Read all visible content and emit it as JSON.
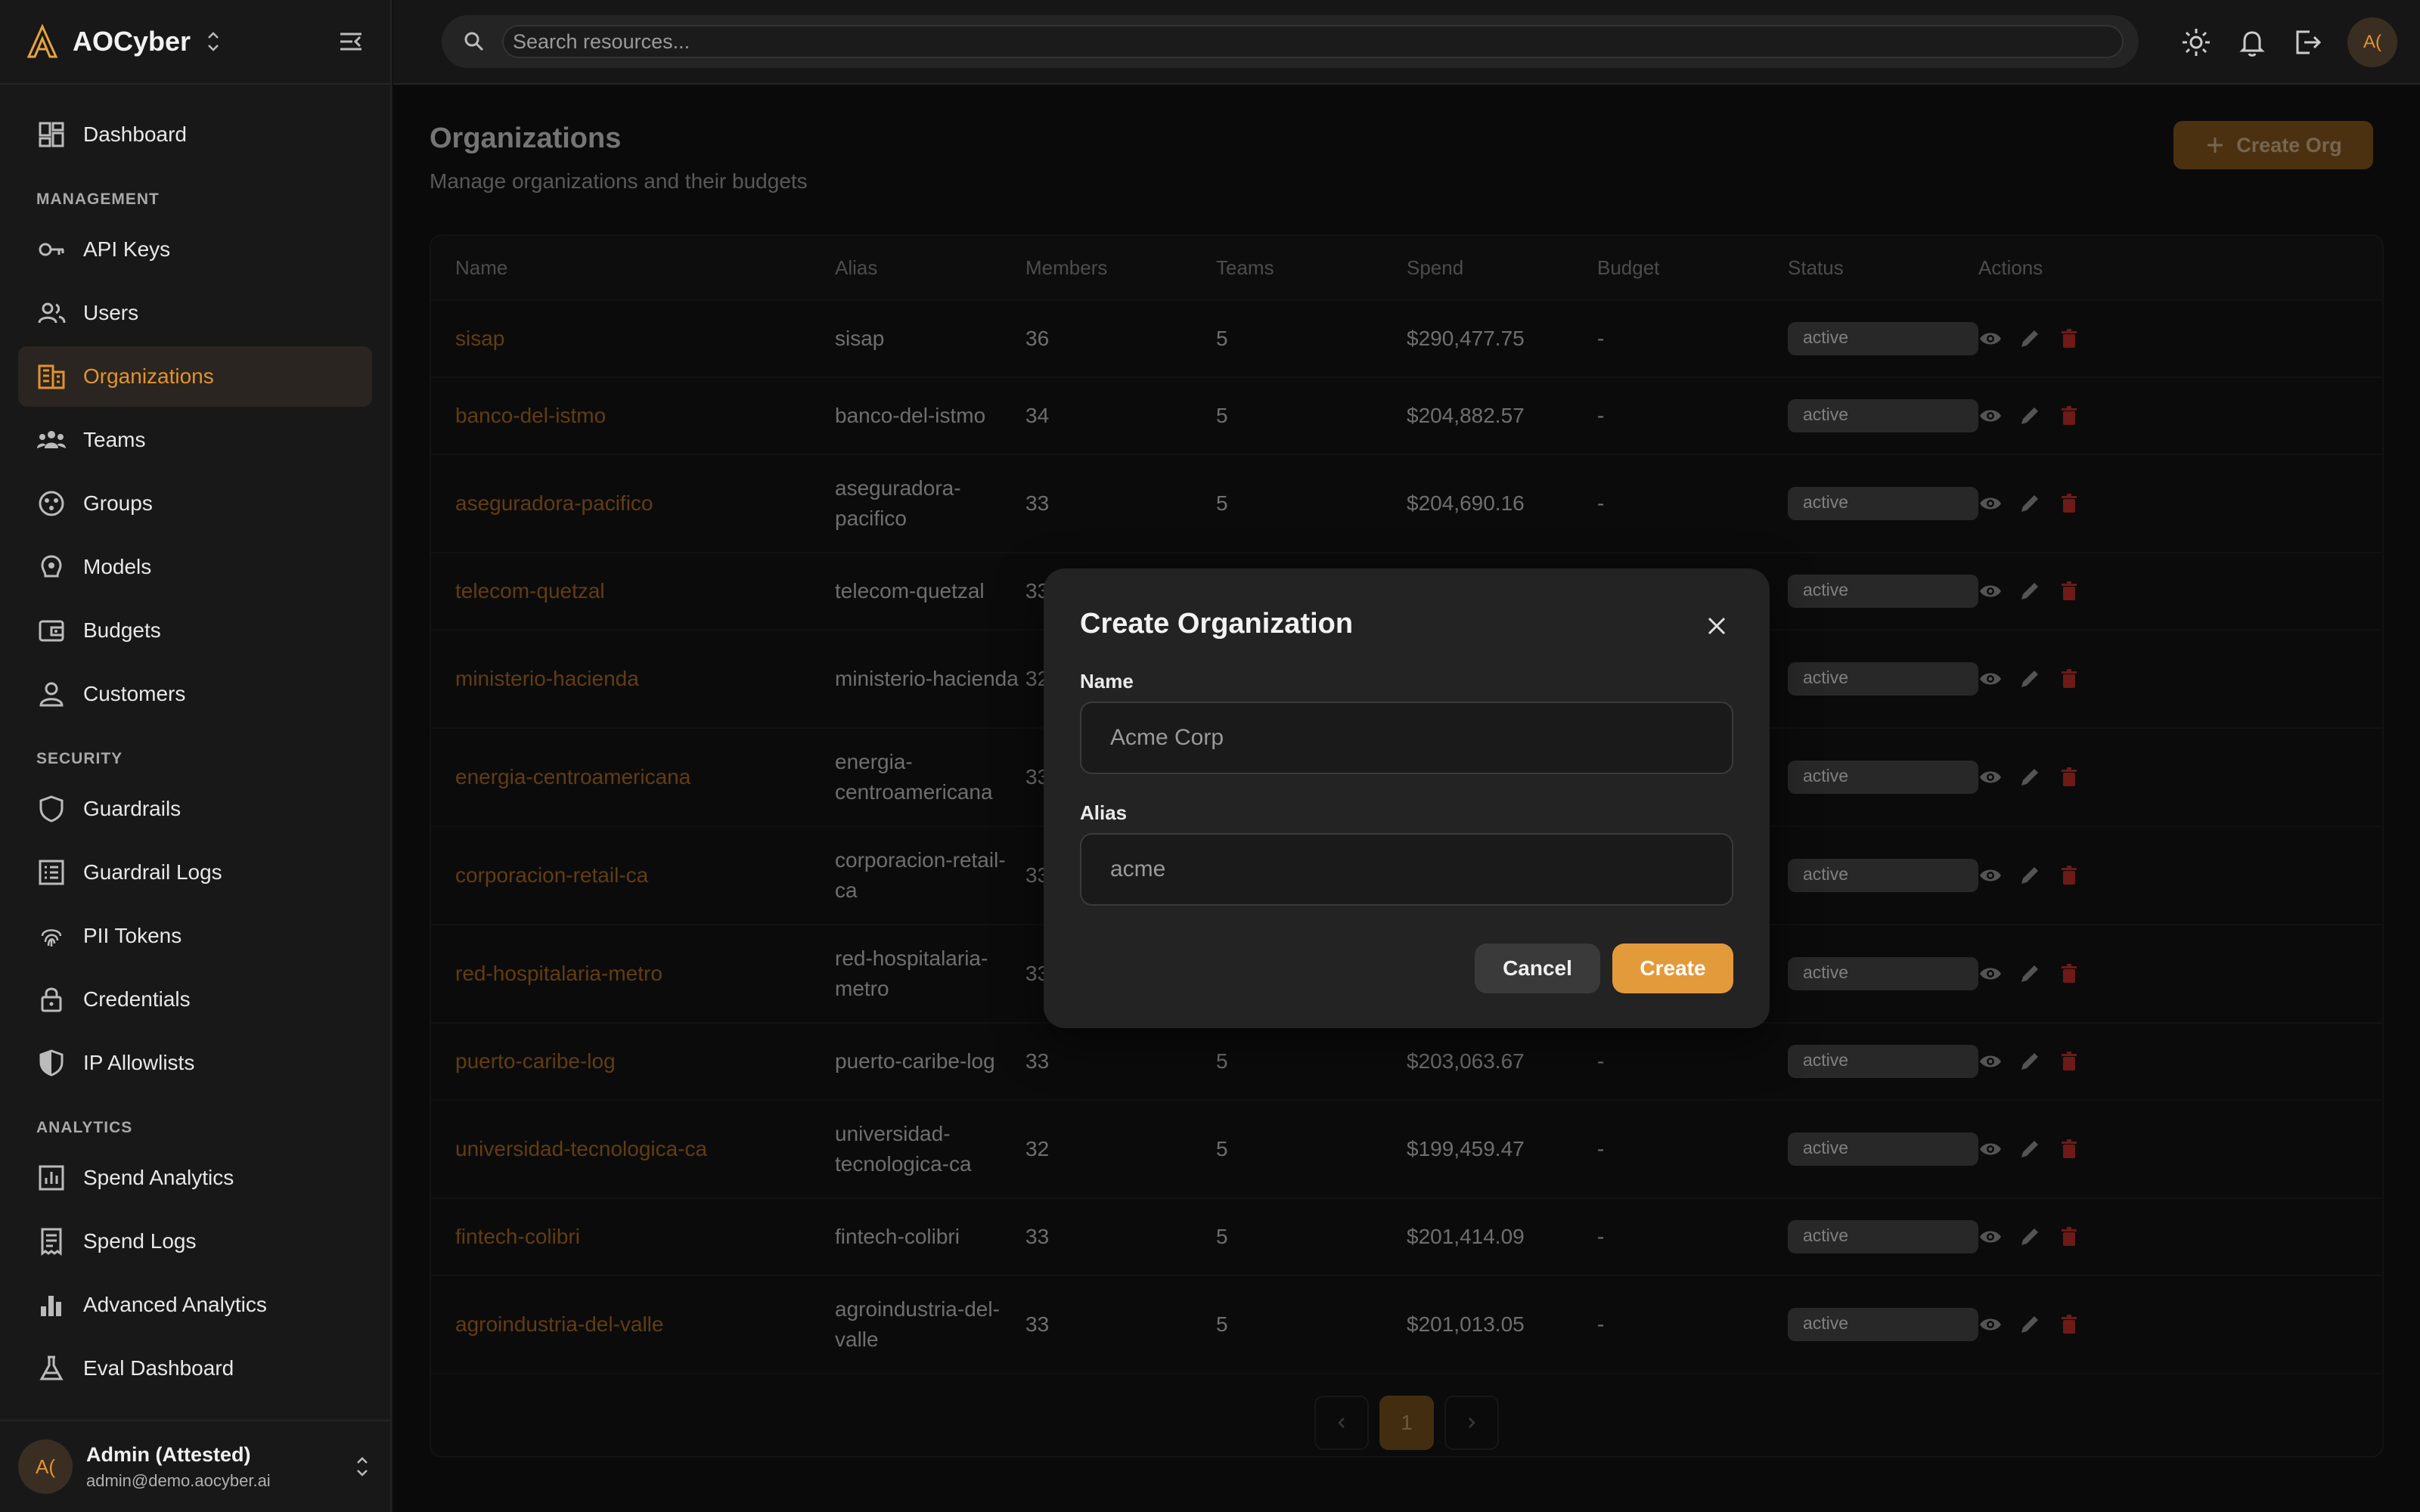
{
  "brand": {
    "name": "AOCyber",
    "logo_icon": "aocyber-logo-icon"
  },
  "sidebar": {
    "items_top": [
      {
        "label": "Dashboard",
        "icon": "dashboard-icon"
      }
    ],
    "sections": [
      {
        "title": "MANAGEMENT",
        "items": [
          {
            "label": "API Keys",
            "icon": "key-icon"
          },
          {
            "label": "Users",
            "icon": "users-icon"
          },
          {
            "label": "Organizations",
            "icon": "building-icon",
            "active": true
          },
          {
            "label": "Teams",
            "icon": "teams-icon"
          },
          {
            "label": "Groups",
            "icon": "groups-icon"
          },
          {
            "label": "Models",
            "icon": "models-icon"
          },
          {
            "label": "Budgets",
            "icon": "wallet-icon"
          },
          {
            "label": "Customers",
            "icon": "person-icon"
          }
        ]
      },
      {
        "title": "SECURITY",
        "items": [
          {
            "label": "Guardrails",
            "icon": "shield-icon"
          },
          {
            "label": "Guardrail Logs",
            "icon": "list-icon"
          },
          {
            "label": "PII Tokens",
            "icon": "fingerprint-icon"
          },
          {
            "label": "Credentials",
            "icon": "lock-icon"
          },
          {
            "label": "IP Allowlists",
            "icon": "shield-half-icon"
          }
        ]
      },
      {
        "title": "ANALYTICS",
        "items": [
          {
            "label": "Spend Analytics",
            "icon": "chart-box-icon"
          },
          {
            "label": "Spend Logs",
            "icon": "receipt-icon"
          },
          {
            "label": "Advanced Analytics",
            "icon": "bar-chart-icon"
          },
          {
            "label": "Eval Dashboard",
            "icon": "flask-icon"
          }
        ]
      }
    ],
    "user": {
      "avatar": "A(",
      "name": "Admin (Attested)",
      "email": "admin@demo.aocyber.ai"
    }
  },
  "topbar": {
    "search_placeholder": "Search resources...",
    "avatar": "A("
  },
  "page": {
    "title": "Organizations",
    "subtitle": "Manage organizations and their budgets",
    "create_button": "Create Org"
  },
  "table": {
    "columns": [
      "Name",
      "Alias",
      "Members",
      "Teams",
      "Spend",
      "Budget",
      "Status",
      "Actions"
    ],
    "rows": [
      {
        "name": "sisap",
        "alias": "sisap",
        "members": "36",
        "teams": "5",
        "spend": "$290,477.75",
        "budget": "-",
        "status": "active"
      },
      {
        "name": "banco-del-istmo",
        "alias": "banco-del-istmo",
        "members": "34",
        "teams": "5",
        "spend": "$204,882.57",
        "budget": "-",
        "status": "active"
      },
      {
        "name": "aseguradora-pacifico",
        "alias": "aseguradora-pacifico",
        "members": "33",
        "teams": "5",
        "spend": "$204,690.16",
        "budget": "-",
        "status": "active"
      },
      {
        "name": "telecom-quetzal",
        "alias": "telecom-quetzal",
        "members": "33",
        "teams": "",
        "spend": "",
        "budget": "",
        "status": "active"
      },
      {
        "name": "ministerio-hacienda",
        "alias": "ministerio-hacienda",
        "members": "32",
        "teams": "",
        "spend": "",
        "budget": "",
        "status": "active"
      },
      {
        "name": "energia-centroamericana",
        "alias": "energia-centroamericana",
        "members": "33",
        "teams": "",
        "spend": "",
        "budget": "",
        "status": "active"
      },
      {
        "name": "corporacion-retail-ca",
        "alias": "corporacion-retail-ca",
        "members": "33",
        "teams": "",
        "spend": "",
        "budget": "",
        "status": "active"
      },
      {
        "name": "red-hospitalaria-metro",
        "alias": "red-hospitalaria-metro",
        "members": "33",
        "teams": "",
        "spend": "",
        "budget": "",
        "status": "active"
      },
      {
        "name": "puerto-caribe-log",
        "alias": "puerto-caribe-log",
        "members": "33",
        "teams": "5",
        "spend": "$203,063.67",
        "budget": "-",
        "status": "active"
      },
      {
        "name": "universidad-tecnologica-ca",
        "alias": "universidad-tecnologica-ca",
        "members": "32",
        "teams": "5",
        "spend": "$199,459.47",
        "budget": "-",
        "status": "active"
      },
      {
        "name": "fintech-colibri",
        "alias": "fintech-colibri",
        "members": "33",
        "teams": "5",
        "spend": "$201,414.09",
        "budget": "-",
        "status": "active"
      },
      {
        "name": "agroindustria-del-valle",
        "alias": "agroindustria-del-valle",
        "members": "33",
        "teams": "5",
        "spend": "$201,013.05",
        "budget": "-",
        "status": "active"
      }
    ]
  },
  "pagination": {
    "current": "1"
  },
  "modal": {
    "title": "Create Organization",
    "name_label": "Name",
    "name_placeholder": "Acme Corp",
    "alias_label": "Alias",
    "alias_placeholder": "acme",
    "cancel_label": "Cancel",
    "create_label": "Create"
  },
  "colors": {
    "accent": "#e39a3b",
    "link": "#b36f22",
    "status_bg": "#4a4a4a"
  }
}
